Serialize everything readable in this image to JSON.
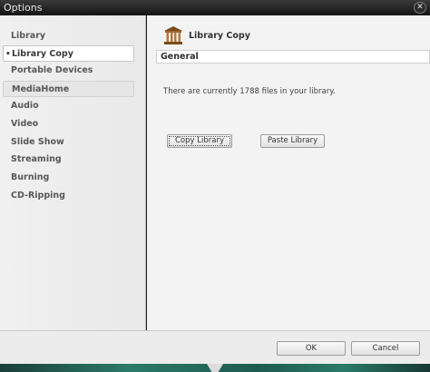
{
  "window": {
    "title": "Options",
    "close_label": "✕"
  },
  "sidebar": {
    "items": [
      {
        "label": "Library"
      },
      {
        "label": "Library Copy",
        "bullet": "•"
      },
      {
        "label": "Portable Devices"
      },
      {
        "label": "MediaHome"
      },
      {
        "label": "Audio"
      },
      {
        "label": "Video"
      },
      {
        "label": "Slide Show"
      },
      {
        "label": "Streaming"
      },
      {
        "label": "Burning"
      },
      {
        "label": "CD-Ripping"
      }
    ],
    "selected": "Library Copy"
  },
  "content": {
    "title": "Library Copy",
    "icon": "library-building-icon",
    "section_header": "General",
    "info_text": "There are currently 1788 files in your library.",
    "copy_button": "Copy Library",
    "paste_button": "Paste Library"
  },
  "footer": {
    "ok_label": "OK",
    "cancel_label": "Cancel"
  },
  "colors": {
    "accent_strip": "#2b7a6a",
    "title_bar": "#1f1f1f"
  }
}
